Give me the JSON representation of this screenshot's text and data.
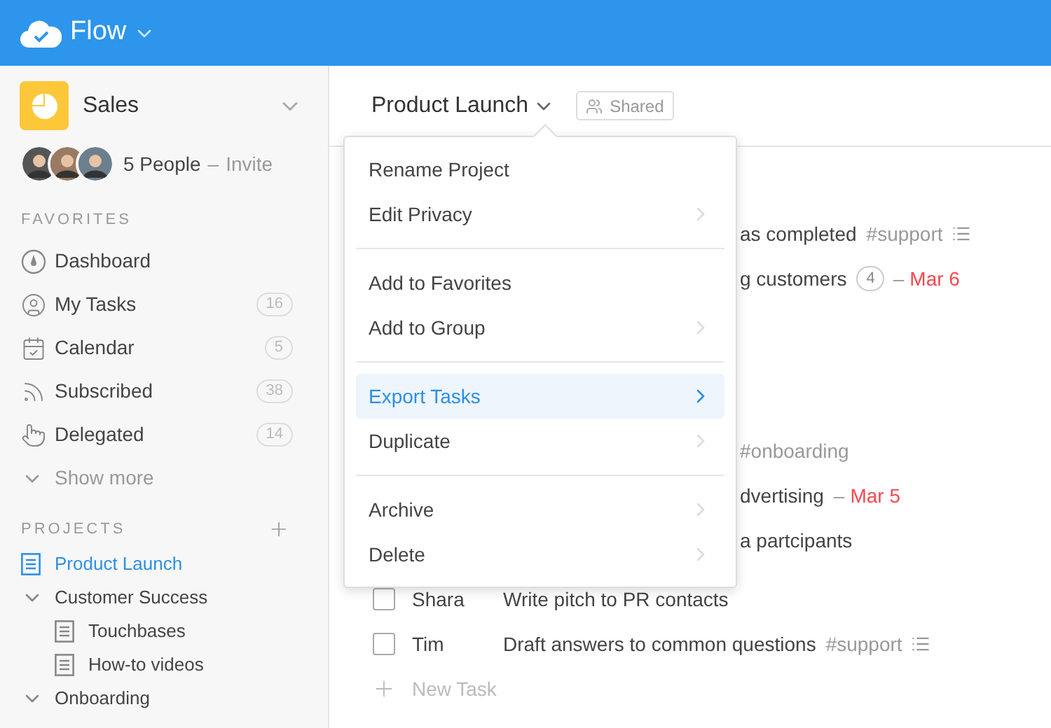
{
  "app": {
    "title": "Flow"
  },
  "workspace": {
    "name": "Sales",
    "people": "5 People",
    "separator": "–",
    "invite": "Invite"
  },
  "favorites": {
    "heading": "FAVORITES",
    "items": [
      {
        "label": "Dashboard"
      },
      {
        "label": "My Tasks",
        "count": "16"
      },
      {
        "label": "Calendar",
        "count": "5"
      },
      {
        "label": "Subscribed",
        "count": "38"
      },
      {
        "label": "Delegated",
        "count": "14"
      }
    ],
    "show_more": "Show more"
  },
  "projects": {
    "heading": "PROJECTS",
    "items": [
      {
        "label": "Product Launch",
        "selected": true
      },
      {
        "label": "Customer Success",
        "selected": false,
        "expanded": true,
        "children": [
          {
            "label": "Touchbases",
            "selected": false
          },
          {
            "label": "How-to videos",
            "selected": false
          }
        ]
      },
      {
        "label": "Onboarding",
        "selected": false,
        "expanded": true
      }
    ]
  },
  "header": {
    "title": "Product Launch",
    "shared": "Shared"
  },
  "menu": {
    "groups": [
      [
        {
          "label": "Rename Project",
          "submenu": false,
          "selected": false
        },
        {
          "label": "Edit Privacy",
          "submenu": true,
          "selected": false
        }
      ],
      [
        {
          "label": "Add to Favorites",
          "submenu": false,
          "selected": false
        },
        {
          "label": "Add to Group",
          "submenu": true,
          "selected": false
        }
      ],
      [
        {
          "label": "Export Tasks",
          "submenu": true,
          "selected": true
        },
        {
          "label": "Duplicate",
          "submenu": true,
          "selected": false
        }
      ],
      [
        {
          "label": "Archive",
          "submenu": true,
          "selected": false
        },
        {
          "label": "Delete",
          "submenu": true,
          "selected": false
        }
      ]
    ]
  },
  "tasks": [
    {
      "kind": "fragment",
      "title": "as completed",
      "tag": "#support",
      "notes": true
    },
    {
      "kind": "fragment",
      "title": "g customers",
      "comments": "4",
      "date_prefix": "–",
      "date": "Mar 6"
    },
    {
      "kind": "fragment",
      "tag": "#onboarding"
    },
    {
      "kind": "fragment",
      "title": "dvertising",
      "date_prefix": "–",
      "date": "Mar 5"
    },
    {
      "kind": "fragment",
      "title": "a partcipants"
    },
    {
      "kind": "task",
      "checked": false,
      "assignee": "Shara",
      "title": "Write pitch to PR contacts"
    },
    {
      "kind": "task",
      "checked": false,
      "assignee": "Tim",
      "title": "Draft answers to common questions",
      "tag": "#support",
      "notes": true
    }
  ],
  "new_task": "New Task"
}
